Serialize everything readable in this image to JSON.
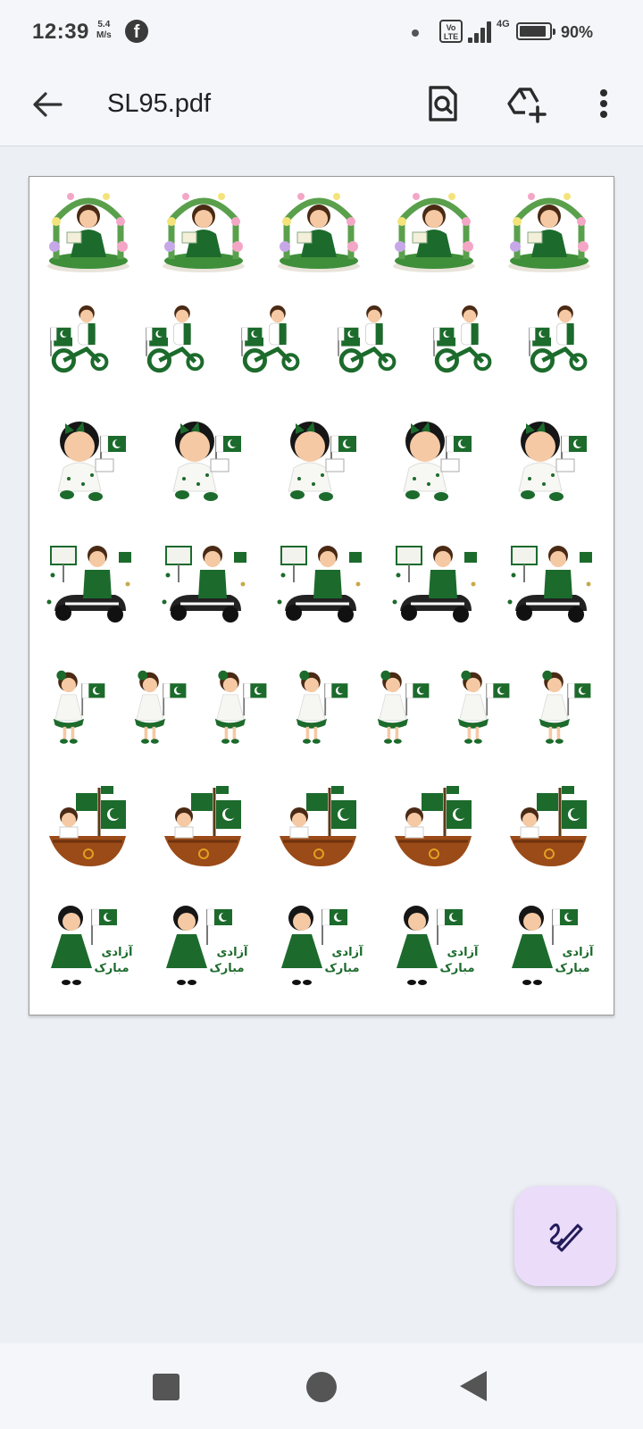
{
  "status_bar": {
    "time": "12:39",
    "net_speed_value": "5.4",
    "net_speed_unit": "M/s",
    "notification_app": "facebook-icon",
    "volte_label": "Vo LTE",
    "network_type": "4G",
    "battery_level": 0.9,
    "battery_percent": "90%"
  },
  "toolbar": {
    "title": "SL95.pdf",
    "back_icon": "arrow-back-icon",
    "search_icon": "document-search-icon",
    "drive_icon": "add-to-drive-icon",
    "more_icon": "more-vertical-icon"
  },
  "document": {
    "sticker_rows": [
      {
        "subject": "girl-in-flower-arch",
        "count": 5
      },
      {
        "subject": "boy-on-tricycle-with-flag",
        "count": 6
      },
      {
        "subject": "baby-girl-with-flag",
        "count": 5
      },
      {
        "subject": "boy-in-go-kart",
        "count": 5
      },
      {
        "subject": "girl-in-dress-with-flag",
        "count": 7
      },
      {
        "subject": "boy-on-ship",
        "count": 5
      },
      {
        "subject": "girl-with-flag-urdu-text",
        "count": 5
      }
    ],
    "sticker_caption": "آزادی مبارک",
    "theme_colors": {
      "green": "#1c6b2c",
      "white": "#ffffff"
    }
  },
  "fab": {
    "icon": "edit-pen-icon",
    "color": "#ebdcfa"
  },
  "nav_bar": {
    "recents_icon": "square-recents-icon",
    "home_icon": "circle-home-icon",
    "back_icon": "triangle-back-icon"
  }
}
